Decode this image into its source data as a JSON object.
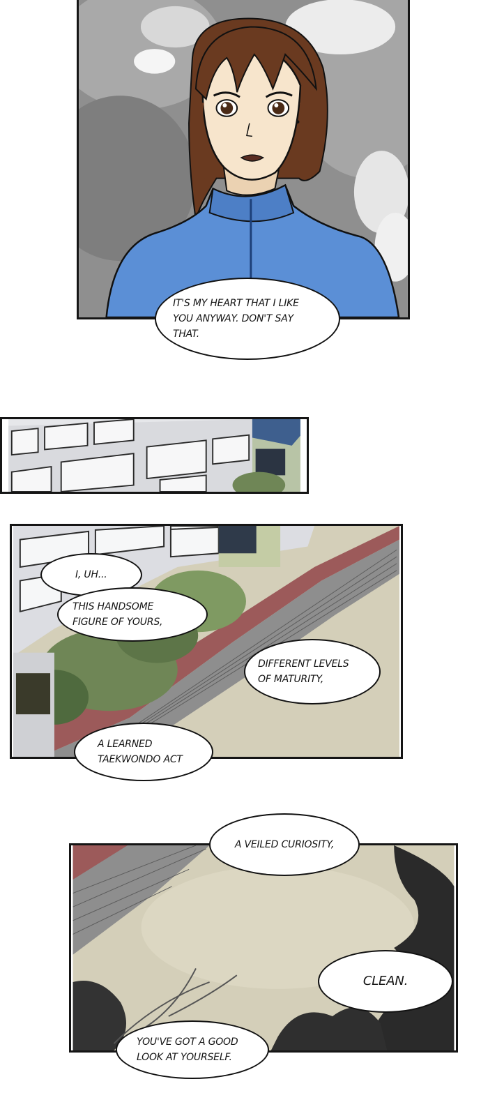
{
  "colors": {
    "ink": "#141414",
    "jacket": "#5b8fd6",
    "hair": "#6a3a20",
    "skin": "#f7e5cc",
    "ground": "#d4cfb9",
    "walkway": "#9c5a5a",
    "building": "#dcdde2",
    "foliage": "#6f8656"
  },
  "panels": [
    {
      "name": "girl-closeup"
    },
    {
      "name": "building-strip"
    },
    {
      "name": "schoolyard-wide"
    },
    {
      "name": "courtyard-ground"
    }
  ],
  "dialogue": {
    "heart": "IT'S MY HEART THAT I LIKE YOU ANYWAY. DON'T SAY THAT.",
    "uh": "I, UH...",
    "handsome": "THIS HANDSOME FIGURE OF YOURS,",
    "maturity": "DIFFERENT LEVELS OF MATURITY,",
    "taekwondo": "A LEARNED TAEKWONDO ACT",
    "curiosity": "A VEILED CURIOSITY,",
    "clean": "CLEAN.",
    "look": "YOU'VE GOT A GOOD LOOK AT YOURSELF."
  }
}
